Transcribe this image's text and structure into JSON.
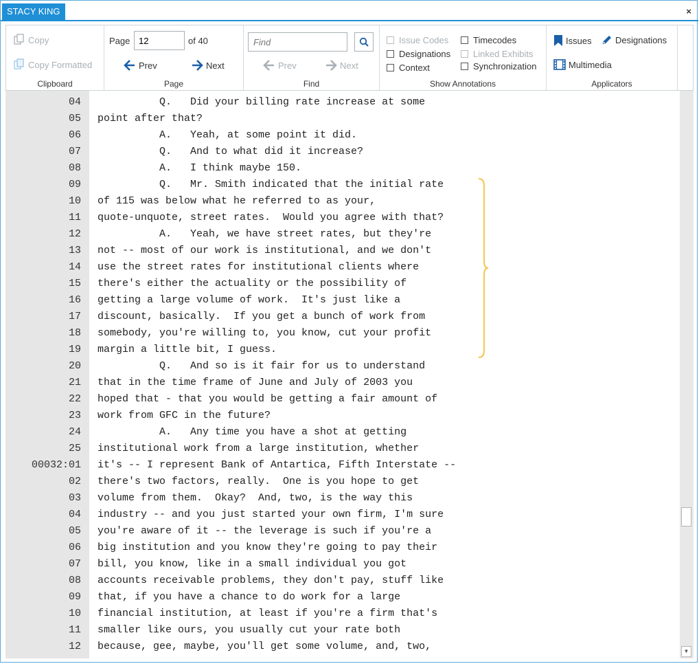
{
  "window": {
    "title": "STACY KING",
    "close_glyph": "×"
  },
  "ribbon": {
    "clipboard": {
      "group_label": "Clipboard",
      "copy_label": "Copy",
      "copy_formatted_label": "Copy Formatted"
    },
    "page": {
      "group_label": "Page",
      "page_label": "Page",
      "page_value": "12",
      "of_label": "of 40",
      "prev_label": "Prev",
      "next_label": "Next"
    },
    "find": {
      "group_label": "Find",
      "placeholder": "Find",
      "prev_label": "Prev",
      "next_label": "Next"
    },
    "annotations": {
      "group_label": "Show Annotations",
      "issue_codes": "Issue Codes",
      "designations": "Designations",
      "context": "Context",
      "timecodes": "Timecodes",
      "linked_exhibits": "Linked Exhibits",
      "synchronization": "Synchronization"
    },
    "applicators": {
      "group_label": "Applicators",
      "issues": "Issues",
      "designations": "Designations",
      "multimedia": "Multimedia"
    }
  },
  "transcript": {
    "lines": [
      {
        "num": "04",
        "text": "          Q.   Did your billing rate increase at some"
      },
      {
        "num": "05",
        "text": "point after that?"
      },
      {
        "num": "06",
        "text": "          A.   Yeah, at some point it did."
      },
      {
        "num": "07",
        "text": "          Q.   And to what did it increase?"
      },
      {
        "num": "08",
        "text": "          A.   I think maybe 150."
      },
      {
        "num": "09",
        "text": "          Q.   Mr. Smith indicated that the initial rate"
      },
      {
        "num": "10",
        "text": "of 115 was below what he referred to as your,"
      },
      {
        "num": "11",
        "text": "quote-unquote, street rates.  Would you agree with that?"
      },
      {
        "num": "12",
        "text": "          A.   Yeah, we have street rates, but they're"
      },
      {
        "num": "13",
        "text": "not -- most of our work is institutional, and we don't"
      },
      {
        "num": "14",
        "text": "use the street rates for institutional clients where"
      },
      {
        "num": "15",
        "text": "there's either the actuality or the possibility of"
      },
      {
        "num": "16",
        "text": "getting a large volume of work.  It's just like a"
      },
      {
        "num": "17",
        "text": "discount, basically.  If you get a bunch of work from"
      },
      {
        "num": "18",
        "text": "somebody, you're willing to, you know, cut your profit"
      },
      {
        "num": "19",
        "text": "margin a little bit, I guess."
      },
      {
        "num": "20",
        "text": "          Q.   And so is it fair for us to understand"
      },
      {
        "num": "21",
        "text": "that in the time frame of June and July of 2003 you"
      },
      {
        "num": "22",
        "text": "hoped that - that you would be getting a fair amount of"
      },
      {
        "num": "23",
        "text": "work from GFC in the future?"
      },
      {
        "num": "24",
        "text": "          A.   Any time you have a shot at getting"
      },
      {
        "num": "25",
        "text": "institutional work from a large institution, whether"
      },
      {
        "num": "00032:01",
        "text": "it's -- I represent Bank of Antartica, Fifth Interstate --"
      },
      {
        "num": "02",
        "text": "there's two factors, really.  One is you hope to get"
      },
      {
        "num": "03",
        "text": "volume from them.  Okay?  And, two, is the way this"
      },
      {
        "num": "04",
        "text": "industry -- and you just started your own firm, I'm sure"
      },
      {
        "num": "05",
        "text": "you're aware of it -- the leverage is such if you're a"
      },
      {
        "num": "06",
        "text": "big institution and you know they're going to pay their"
      },
      {
        "num": "07",
        "text": "bill, you know, like in a small individual you got"
      },
      {
        "num": "08",
        "text": "accounts receivable problems, they don't pay, stuff like"
      },
      {
        "num": "09",
        "text": "that, if you have a chance to do work for a large"
      },
      {
        "num": "10",
        "text": "financial institution, at least if you're a firm that's"
      },
      {
        "num": "11",
        "text": "smaller like ours, you usually cut your rate both"
      },
      {
        "num": "12",
        "text": "because, gee, maybe, you'll get some volume, and, two,"
      }
    ]
  },
  "colors": {
    "accent": "#1f8fd6",
    "bracket": "#f5c85a",
    "icon_blue": "#1a5fa8",
    "disabled": "#a9b0b5"
  },
  "icons": {
    "copy": "copy-icon",
    "copy_formatted": "copy-formatted-icon",
    "prev": "arrow-left-icon",
    "next": "arrow-right-icon",
    "search": "search-icon",
    "issues": "bookmark-icon",
    "designations": "pencil-icon",
    "multimedia": "film-icon"
  }
}
